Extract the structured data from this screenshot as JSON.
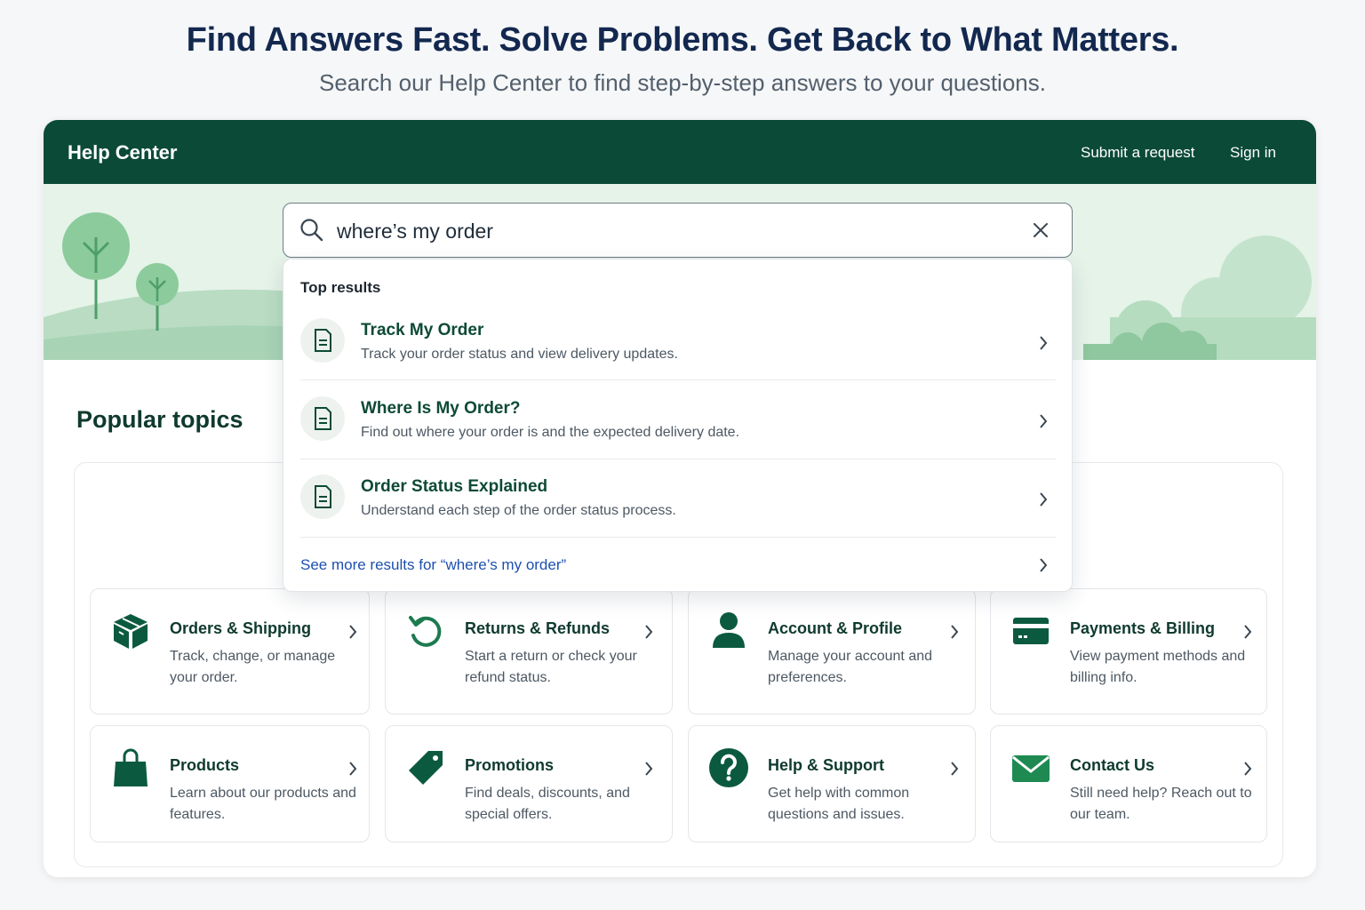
{
  "hero": {
    "title": "Find Answers Fast.  Solve Problems.  Get Back to What Matters.",
    "subtitle": "Search our Help Center to find step-by-step answers to your questions."
  },
  "topbar": {
    "brand": "Help Center",
    "submit_request": "Submit a request",
    "sign_in": "Sign in"
  },
  "search": {
    "value": "where’s my order",
    "heading": "Top results",
    "results": [
      {
        "title": "Track My Order",
        "desc": "Track your order status and view delivery updates."
      },
      {
        "title": "Where Is My Order?",
        "desc": "Find out where your order is and the expected delivery date."
      },
      {
        "title": "Order Status Explained",
        "desc": "Understand each step of the order status process."
      }
    ],
    "see_more": "See more results for “where’s my order”"
  },
  "popular": {
    "title": "Popular topics",
    "topics": [
      {
        "title": "Orders & Shipping",
        "desc": "Track, change, or manage your order.",
        "icon": "package-icon"
      },
      {
        "title": "Returns & Refunds",
        "desc": "Start a return or check your refund status.",
        "icon": "return-arrow-icon"
      },
      {
        "title": "Account & Profile",
        "desc": "Manage your account and preferences.",
        "icon": "user-icon"
      },
      {
        "title": "Payments & Billing",
        "desc": "View payment methods and billing info.",
        "icon": "credit-card-icon"
      },
      {
        "title": "Products",
        "desc": "Learn about our products and features.",
        "icon": "shopping-bag-icon"
      },
      {
        "title": "Promotions",
        "desc": "Find deals, discounts, and special offers.",
        "icon": "tag-icon"
      },
      {
        "title": "Help & Support",
        "desc": "Get help with common questions and issues.",
        "icon": "question-icon"
      },
      {
        "title": "Contact Us",
        "desc": "Still need help? Reach out to our team.",
        "icon": "envelope-icon"
      }
    ]
  },
  "colors": {
    "brand_dark_green": "#0b4a37",
    "banner_green": "#e5f3e9",
    "link_blue": "#1d4fb0",
    "heading_navy": "#13284f"
  }
}
